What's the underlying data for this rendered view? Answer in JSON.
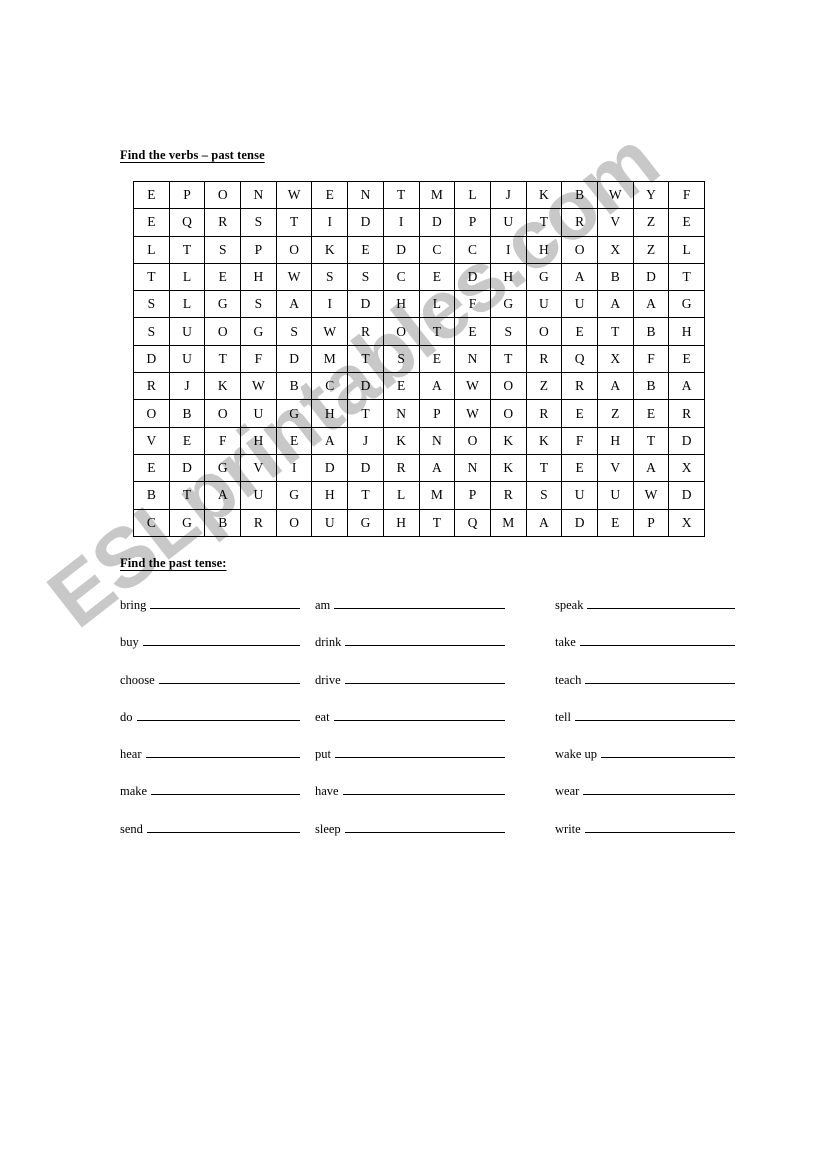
{
  "document": {
    "type": "worksheet",
    "watermark": "ESLprintables.com"
  },
  "sections": {
    "wordsearch": {
      "heading": "Find the verbs – past tense",
      "rows": 13,
      "cols": 16,
      "grid": [
        [
          "E",
          "P",
          "O",
          "N",
          "W",
          "E",
          "N",
          "T",
          "M",
          "L",
          "J",
          "K",
          "B",
          "W",
          "Y",
          "F"
        ],
        [
          "E",
          "Q",
          "R",
          "S",
          "T",
          "I",
          "D",
          "I",
          "D",
          "P",
          "U",
          "T",
          "R",
          "V",
          "Z",
          "E"
        ],
        [
          "L",
          "T",
          "S",
          "P",
          "O",
          "K",
          "E",
          "D",
          "C",
          "C",
          "I",
          "H",
          "O",
          "X",
          "Z",
          "L"
        ],
        [
          "T",
          "L",
          "E",
          "H",
          "W",
          "S",
          "S",
          "C",
          "E",
          "D",
          "H",
          "G",
          "A",
          "B",
          "D",
          "T"
        ],
        [
          "S",
          "L",
          "G",
          "S",
          "A",
          "I",
          "D",
          "H",
          "L",
          "F",
          "G",
          "U",
          "U",
          "A",
          "A",
          "G"
        ],
        [
          "S",
          "U",
          "O",
          "G",
          "S",
          "W",
          "R",
          "O",
          "T",
          "E",
          "S",
          "O",
          "E",
          "T",
          "B",
          "H"
        ],
        [
          "D",
          "U",
          "T",
          "F",
          "D",
          "M",
          "T",
          "S",
          "E",
          "N",
          "T",
          "R",
          "Q",
          "X",
          "F",
          "E"
        ],
        [
          "R",
          "J",
          "K",
          "W",
          "B",
          "C",
          "D",
          "E",
          "A",
          "W",
          "O",
          "Z",
          "R",
          "A",
          "B",
          "A"
        ],
        [
          "O",
          "B",
          "O",
          "U",
          "G",
          "H",
          "T",
          "N",
          "P",
          "W",
          "O",
          "R",
          "E",
          "Z",
          "E",
          "R"
        ],
        [
          "V",
          "E",
          "F",
          "H",
          "E",
          "A",
          "J",
          "K",
          "N",
          "O",
          "K",
          "K",
          "F",
          "H",
          "T",
          "D"
        ],
        [
          "E",
          "D",
          "G",
          "V",
          "I",
          "D",
          "D",
          "R",
          "A",
          "N",
          "K",
          "T",
          "E",
          "V",
          "A",
          "X"
        ],
        [
          "B",
          "T",
          "A",
          "U",
          "G",
          "H",
          "T",
          "L",
          "M",
          "P",
          "R",
          "S",
          "U",
          "U",
          "W",
          "D"
        ],
        [
          "C",
          "G",
          "B",
          "R",
          "O",
          "U",
          "G",
          "H",
          "T",
          "Q",
          "M",
          "A",
          "D",
          "E",
          "P",
          "X"
        ]
      ]
    },
    "past_tense": {
      "heading": "Find the past tense:",
      "columns": [
        {
          "verbs": [
            {
              "label": "bring",
              "answer": ""
            },
            {
              "label": "buy",
              "answer": ""
            },
            {
              "label": "choose",
              "answer": ""
            },
            {
              "label": "do",
              "answer": ""
            },
            {
              "label": "hear",
              "answer": ""
            },
            {
              "label": "make",
              "answer": ""
            },
            {
              "label": "send",
              "answer": ""
            }
          ]
        },
        {
          "verbs": [
            {
              "label": "am",
              "answer": ""
            },
            {
              "label": "drink",
              "answer": ""
            },
            {
              "label": "drive",
              "answer": ""
            },
            {
              "label": "eat",
              "answer": ""
            },
            {
              "label": "put",
              "answer": ""
            },
            {
              "label": "have",
              "answer": ""
            },
            {
              "label": "sleep",
              "answer": ""
            }
          ]
        },
        {
          "verbs": [
            {
              "label": "speak",
              "answer": ""
            },
            {
              "label": "take",
              "answer": ""
            },
            {
              "label": "teach",
              "answer": ""
            },
            {
              "label": "tell",
              "answer": ""
            },
            {
              "label": "wake up",
              "answer": ""
            },
            {
              "label": "wear",
              "answer": ""
            },
            {
              "label": "write",
              "answer": ""
            }
          ]
        }
      ]
    }
  }
}
